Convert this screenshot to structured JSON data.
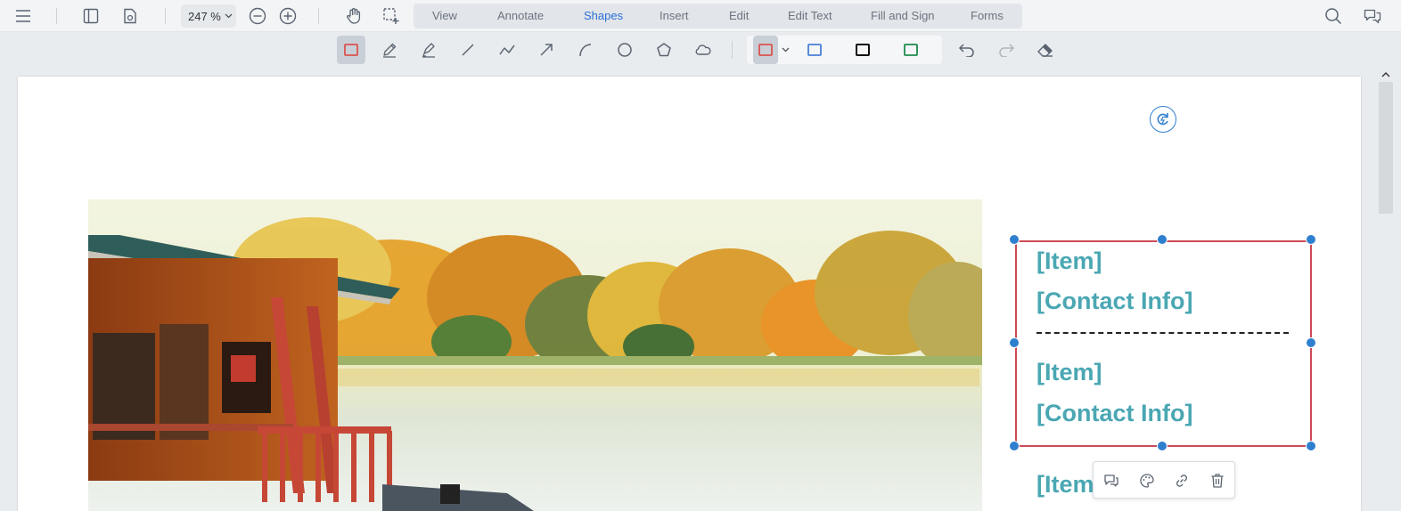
{
  "toolbar": {
    "zoom": "247 %",
    "tabs": [
      {
        "label": "View"
      },
      {
        "label": "Annotate"
      },
      {
        "label": "Shapes"
      },
      {
        "label": "Insert"
      },
      {
        "label": "Edit"
      },
      {
        "label": "Edit Text"
      },
      {
        "label": "Fill and Sign"
      },
      {
        "label": "Forms"
      }
    ],
    "active_tab": "Shapes",
    "icons": [
      "menu-icon",
      "sidebar-icon",
      "document-settings-icon",
      "zoom-out-icon",
      "zoom-in-icon",
      "pan-hand-icon",
      "marquee-select-icon",
      "search-icon",
      "comments-icon"
    ]
  },
  "shape_toolbar": {
    "tools": [
      "rectangle-icon",
      "pen-icon",
      "highlighter-icon",
      "line-icon",
      "polyline-icon",
      "arrow-icon",
      "arc-icon",
      "ellipse-icon",
      "polygon-icon",
      "cloud-icon"
    ],
    "selected_tool": "rectangle-icon",
    "style_presets": [
      {
        "color": "#d9534f"
      },
      {
        "color": "#4a7fd6"
      },
      {
        "color": "#111111"
      },
      {
        "color": "#1e8a4a"
      }
    ],
    "actions": [
      "undo-icon",
      "redo-icon",
      "eraser-icon"
    ]
  },
  "document": {
    "lines": [
      {
        "text": "[Item]"
      },
      {
        "text": "[Contact Info]"
      },
      {
        "text": "[Item]"
      },
      {
        "text": "[Contact Info]"
      },
      {
        "text": "[Item]"
      }
    ],
    "text_color": "#4aa7b3",
    "selection_color": "#cc4a57",
    "handle_color": "#2f7fcf"
  },
  "annotation_popup": {
    "actions": [
      "comment-icon",
      "style-palette-icon",
      "link-icon",
      "delete-icon"
    ]
  }
}
